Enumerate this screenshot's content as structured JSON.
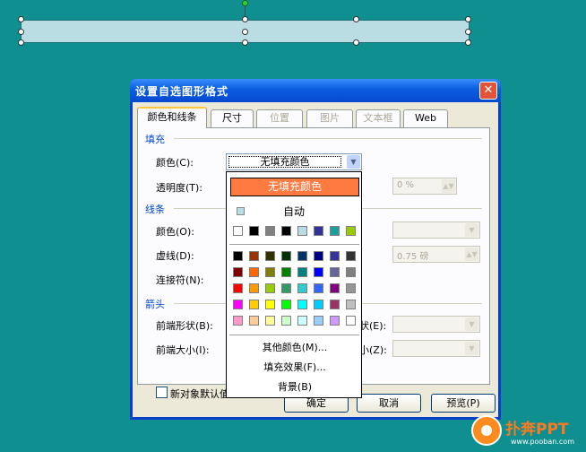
{
  "dialog": {
    "title": "设置自选图形格式",
    "close": "✕",
    "tabs": [
      {
        "label": "颜色和线条",
        "state": "active"
      },
      {
        "label": "尺寸",
        "state": "enabled"
      },
      {
        "label": "位置",
        "state": "disabled"
      },
      {
        "label": "图片",
        "state": "disabled"
      },
      {
        "label": "文本框",
        "state": "disabled"
      },
      {
        "label": "Web",
        "state": "enabled"
      }
    ],
    "fill": {
      "section": "填充",
      "color_label": "颜色(C):",
      "color_value": "无填充颜色",
      "transparency_label": "透明度(T):",
      "transparency_value": "0 %"
    },
    "line": {
      "section": "线条",
      "color_label": "颜色(O):",
      "dash_label": "虚线(D):",
      "connector_label": "连接符(N):",
      "weight_value": "0.75 磅"
    },
    "arrows": {
      "section": "箭头",
      "begin_style_label": "前端形状(B):",
      "begin_size_label": "前端大小(I):",
      "end_style_partial": "状(E):",
      "end_size_partial": "小(Z):"
    },
    "default_checkbox_label": "新对象默认值",
    "buttons": {
      "ok": "确定",
      "cancel": "取消",
      "preview": "预览(P)"
    }
  },
  "palette": {
    "no_fill": "无填充颜色",
    "auto": "自动",
    "recent_colors": [
      "#ffffff",
      "#000000",
      "#808080",
      "#000000",
      "#b9dde3",
      "#333399",
      "#1f9e9e",
      "#99cc00"
    ],
    "standard_colors": [
      [
        "#000000",
        "#993300",
        "#333300",
        "#003300",
        "#003366",
        "#000080",
        "#333399",
        "#333333"
      ],
      [
        "#800000",
        "#ff6600",
        "#808000",
        "#008000",
        "#008080",
        "#0000ff",
        "#666699",
        "#808080"
      ],
      [
        "#ff0000",
        "#ff9900",
        "#99cc00",
        "#339966",
        "#33cccc",
        "#3366ff",
        "#800080",
        "#969696"
      ],
      [
        "#ff00ff",
        "#ffcc00",
        "#ffff00",
        "#00ff00",
        "#00ffff",
        "#00ccff",
        "#993366",
        "#c0c0c0"
      ],
      [
        "#ff99cc",
        "#ffcc99",
        "#ffff99",
        "#ccffcc",
        "#ccffff",
        "#99ccff",
        "#cc99ff",
        "#ffffff"
      ]
    ],
    "more_colors": "其他颜色(M)...",
    "fill_effects": "填充效果(F)...",
    "background": "背景(B)"
  },
  "watermark": {
    "brand": "扑奔PPT",
    "url": "www.pooban.com"
  },
  "colors": {
    "desktop": "#0f8f8f",
    "shape_fill": "#b9dde3",
    "accent_no_fill": "#ff7a40",
    "title_blue": "#0a5ce0"
  }
}
